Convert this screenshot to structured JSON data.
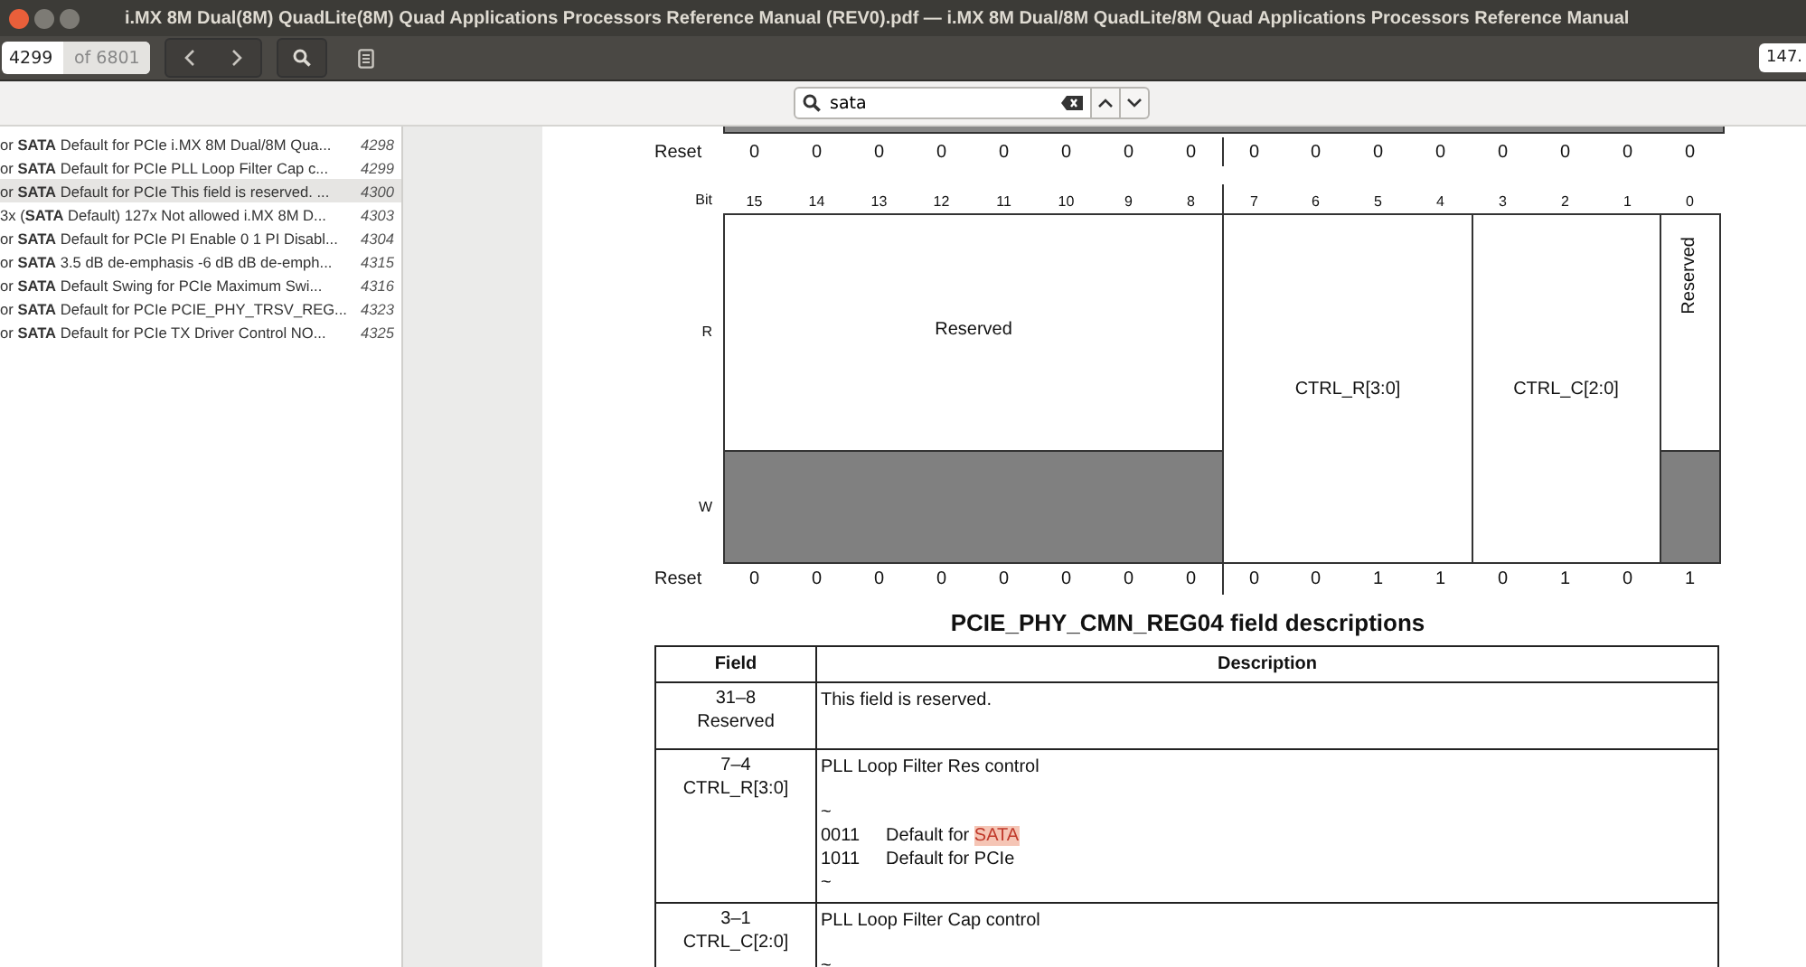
{
  "window": {
    "title": "i.MX 8M Dual(8M) QuadLite(8M) Quad Applications Processors Reference Manual (REV0).pdf — i.MX 8M Dual/8M QuadLite/8M Quad Applications Processors Reference Manual"
  },
  "toolbar": {
    "page": "4299",
    "page_total": "of 6801",
    "zoom": "147."
  },
  "search": {
    "value": "sata"
  },
  "results": [
    {
      "text": "or **SATA** Default for PCIe i.MX 8M Dual/8M Qua...",
      "page": "4298",
      "selected": false
    },
    {
      "text": "or **SATA** Default for PCIe PLL Loop Filter Cap c...",
      "page": "4299",
      "selected": false
    },
    {
      "text": "or **SATA** Default for PCIe This field is reserved. ...",
      "page": "4300",
      "selected": true
    },
    {
      "text": "3x (**SATA** Default) 127x Not allowed i.MX 8M D...",
      "page": "4303",
      "selected": false
    },
    {
      "text": "or **SATA** Default for PCIe PI Enable 0 1 PI Disabl...",
      "page": "4304",
      "selected": false
    },
    {
      "text": "or **SATA** 3.5 dB de-emphasis -6 dB dB de-emph...",
      "page": "4315",
      "selected": false
    },
    {
      "text": "or **SATA** Default Swing for PCIe Maximum Swi...",
      "page": "4316",
      "selected": false
    },
    {
      "text": "or **SATA** Default for PCIe PCIE_PHY_TRSV_REG...",
      "page": "4323",
      "selected": false
    },
    {
      "text": "or **SATA** Default for PCIe TX Driver Control NO...",
      "page": "4325",
      "selected": false
    }
  ],
  "register": {
    "reset_top": {
      "label": "Reset",
      "values": [
        "0",
        "0",
        "0",
        "0",
        "0",
        "0",
        "0",
        "0",
        "0",
        "0",
        "0",
        "0",
        "0",
        "0",
        "0",
        "0"
      ]
    },
    "bit_label": "Bit",
    "bits": [
      "15",
      "14",
      "13",
      "12",
      "11",
      "10",
      "9",
      "8",
      "7",
      "6",
      "5",
      "4",
      "3",
      "2",
      "1",
      "0"
    ],
    "read_label": "R",
    "write_label": "W",
    "fields": [
      {
        "name": "Reserved",
        "kind": "reserved",
        "vertical": false
      },
      {
        "name": "CTRL_R[3:0]",
        "kind": "rw",
        "vertical": false
      },
      {
        "name": "CTRL_C[2:0]",
        "kind": "rw",
        "vertical": false
      },
      {
        "name": "Reserved",
        "kind": "reserved",
        "vertical": true
      }
    ],
    "reset_bottom": {
      "label": "Reset",
      "values": [
        "0",
        "0",
        "0",
        "0",
        "0",
        "0",
        "0",
        "0",
        "0",
        "0",
        "1",
        "1",
        "0",
        "1",
        "0",
        "1"
      ]
    }
  },
  "table": {
    "title": "PCIE_PHY_CMN_REG04 field descriptions",
    "columns": [
      "Field",
      "Description"
    ],
    "rows": [
      {
        "field": [
          "31–8",
          "Reserved"
        ],
        "description": [
          {
            "kind": "text",
            "text": "This field is reserved."
          }
        ]
      },
      {
        "field": [
          "7–4",
          "CTRL_R[3:0]"
        ],
        "description": [
          {
            "kind": "text",
            "text": "PLL Loop Filter Res control"
          },
          {
            "kind": "text",
            "text": "~"
          },
          {
            "kind": "value",
            "code": "0011",
            "text": "Default for ",
            "match": "SATA"
          },
          {
            "kind": "value",
            "code": "1011",
            "text": "Default for PCIe"
          },
          {
            "kind": "text",
            "text": "~"
          }
        ]
      },
      {
        "field": [
          "3–1",
          "CTRL_C[2:0]"
        ],
        "description": [
          {
            "kind": "text",
            "text": "PLL Loop Filter Cap control"
          },
          {
            "kind": "text",
            "text": "~"
          }
        ]
      }
    ]
  }
}
